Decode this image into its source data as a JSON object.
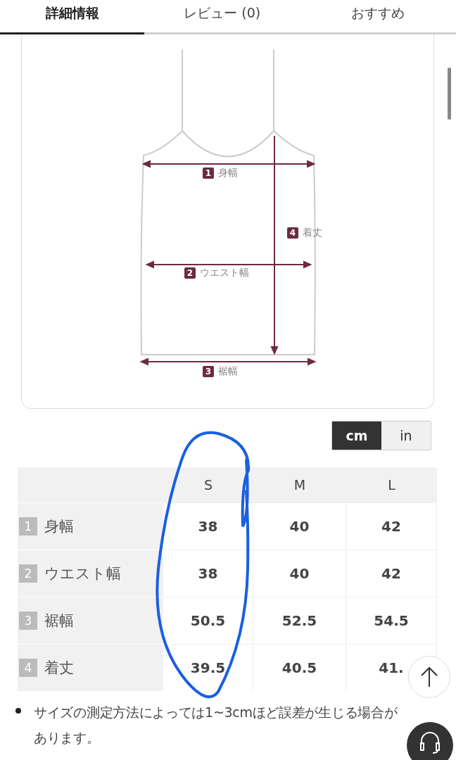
{
  "tabs": [
    {
      "label": "詳細情報",
      "selected": true
    },
    {
      "label": "レビュー (0)",
      "selected": false
    },
    {
      "label": "おすすめ",
      "selected": false
    }
  ],
  "diagram": {
    "labels": [
      {
        "number": "1",
        "text": "身幅"
      },
      {
        "number": "2",
        "text": "ウエスト幅"
      },
      {
        "number": "3",
        "text": "裾幅"
      },
      {
        "number": "4",
        "text": "着丈"
      }
    ]
  },
  "units": [
    {
      "label": "cm",
      "selected": true
    },
    {
      "label": "in",
      "selected": false
    }
  ],
  "size_table": {
    "columns": [
      "S",
      "M",
      "L"
    ],
    "rows": [
      {
        "number": "1",
        "label": "身幅",
        "values": [
          "38",
          "40",
          "42"
        ]
      },
      {
        "number": "2",
        "label": "ウエスト幅",
        "values": [
          "38",
          "40",
          "42"
        ]
      },
      {
        "number": "3",
        "label": "裾幅",
        "values": [
          "50.5",
          "52.5",
          "54.5"
        ]
      },
      {
        "number": "4",
        "label": "着丈",
        "values": [
          "39.5",
          "40.5",
          "41."
        ]
      }
    ]
  },
  "notes": [
    "サイズの測定方法によっては1~3cmほど誤差が生じる場合があります。"
  ]
}
